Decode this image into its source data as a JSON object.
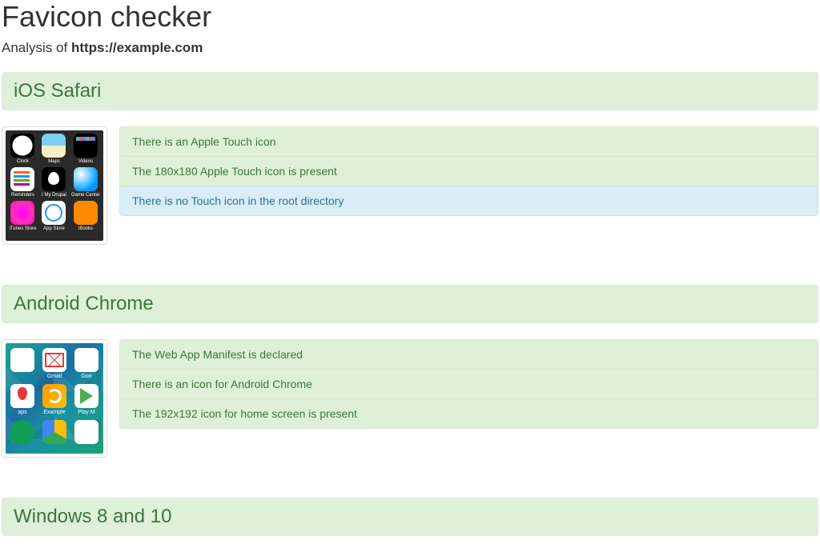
{
  "header": {
    "title": "Favicon checker",
    "subtitle_prefix": "Analysis of ",
    "subtitle_url": "https://example.com"
  },
  "sections": [
    {
      "title": "iOS Safari",
      "thumb": {
        "type": "ios",
        "apps": [
          {
            "label": "Clock",
            "icon": "ic-clock"
          },
          {
            "label": "Maps",
            "icon": "ic-maps"
          },
          {
            "label": "Videos",
            "icon": "ic-videos"
          },
          {
            "label": "Reminders",
            "icon": "ic-remind"
          },
          {
            "label": "I My Drupal",
            "icon": "ic-drupal"
          },
          {
            "label": "Game Center",
            "icon": "ic-gc"
          },
          {
            "label": "iTunes Store",
            "icon": "ic-itunes"
          },
          {
            "label": "App Store",
            "icon": "ic-appstore"
          },
          {
            "label": "iBooks",
            "icon": "ic-ibooks"
          }
        ]
      },
      "messages": [
        {
          "type": "success",
          "text": "There is an Apple Touch icon"
        },
        {
          "type": "success",
          "text": "The 180x180 Apple Touch icon is present"
        },
        {
          "type": "info",
          "text": "There is no Touch icon in the root directory"
        }
      ]
    },
    {
      "title": "Android Chrome",
      "thumb": {
        "type": "android",
        "apps": [
          {
            "label": "",
            "icon": "ic-yt"
          },
          {
            "label": "Gmail",
            "icon": "ic-gmail"
          },
          {
            "label": "Goo",
            "icon": "ic-goo"
          },
          {
            "label": "aps",
            "icon": "ic-gmaps"
          },
          {
            "label": "Example",
            "icon": "ic-example"
          },
          {
            "label": "Play M",
            "icon": "ic-play"
          },
          {
            "label": "",
            "icon": "ic-hang"
          },
          {
            "label": "",
            "icon": "ic-drive"
          },
          {
            "label": "",
            "icon": "ic-goo"
          }
        ]
      },
      "messages": [
        {
          "type": "success",
          "text": "The Web App Manifest is declared"
        },
        {
          "type": "success",
          "text": "There is an icon for Android Chrome"
        },
        {
          "type": "success",
          "text": "The 192x192 icon for home screen is present"
        }
      ]
    },
    {
      "title": "Windows 8 and 10",
      "thumb": null,
      "messages": []
    }
  ]
}
